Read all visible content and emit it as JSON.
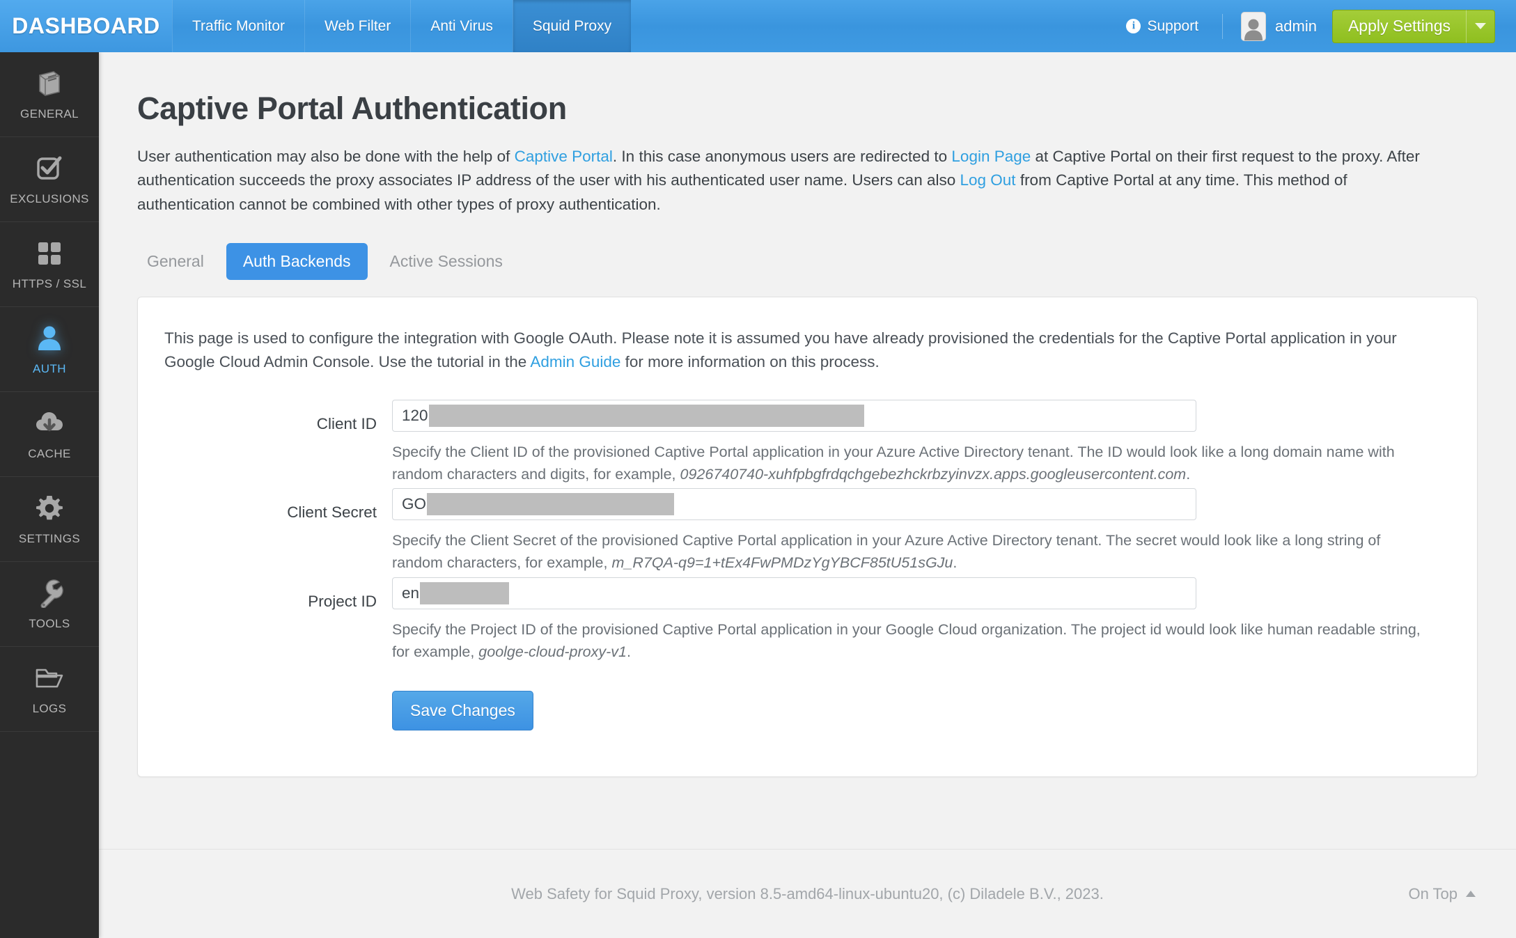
{
  "header": {
    "brand": "DASHBOARD",
    "nav": [
      {
        "label": "Traffic Monitor",
        "active": false
      },
      {
        "label": "Web Filter",
        "active": false
      },
      {
        "label": "Anti Virus",
        "active": false
      },
      {
        "label": "Squid Proxy",
        "active": true
      }
    ],
    "support_label": "Support",
    "support_icon": "info-icon",
    "user_name": "admin",
    "avatar_icon": "user-avatar-icon",
    "apply_label": "Apply Settings",
    "apply_caret_icon": "chevron-down-icon",
    "accent_blue": "#3a95de",
    "apply_green": "#8fbf1f"
  },
  "sidebar": {
    "items": [
      {
        "label": "GENERAL",
        "icon": "book-icon",
        "active": false
      },
      {
        "label": "EXCLUSIONS",
        "icon": "check-box-icon",
        "active": false
      },
      {
        "label": "HTTPS / SSL",
        "icon": "grid-icon",
        "active": false
      },
      {
        "label": "AUTH",
        "icon": "user-icon",
        "active": true
      },
      {
        "label": "CACHE",
        "icon": "cloud-download-icon",
        "active": false
      },
      {
        "label": "SETTINGS",
        "icon": "gear-icon",
        "active": false
      },
      {
        "label": "TOOLS",
        "icon": "wrench-icon",
        "active": false
      },
      {
        "label": "LOGS",
        "icon": "folder-icon",
        "active": false
      }
    ],
    "active_color": "#5bb8f5"
  },
  "page": {
    "title": "Captive Portal Authentication",
    "intro": {
      "p1": "User authentication may also be done with the help of ",
      "link1": "Captive Portal",
      "p2": ". In this case anonymous users are redirected to ",
      "link2": "Login Page",
      "p3": " at Captive Portal on their first request to the proxy. After authentication succeeds the proxy associates IP address of the user with his authenticated user name. Users can also ",
      "link3": "Log Out",
      "p4": " from Captive Portal at any time. This method of authentication cannot be combined with other types of proxy authentication."
    }
  },
  "tabs": [
    {
      "label": "General",
      "active": false
    },
    {
      "label": "Auth Backends",
      "active": true
    },
    {
      "label": "Active Sessions",
      "active": false
    }
  ],
  "panel": {
    "desc_part1": "This page is used to configure the integration with Google OAuth. Please note it is assumed you have already provisioned the credentials for the Captive Portal application in your Google Cloud Admin Console. Use the tutorial in the ",
    "desc_link": "Admin Guide",
    "desc_part2": " for more information on this process.",
    "fields": [
      {
        "label": "Client ID",
        "value": "120",
        "redacted": true,
        "redact_width": 625,
        "help_text": "Specify the Client ID of the provisioned Captive Portal application in your Azure Active Directory tenant. The ID would look like a long domain name with random characters and digits, for example, ",
        "help_example": "0926740740-xuhfpbgfrdqchgebezhckrbzyinvzx.apps.googleusercontent.com",
        "help_suffix": "."
      },
      {
        "label": "Client Secret",
        "value": "GO",
        "redacted": true,
        "redact_width": 355,
        "help_text": "Specify the Client Secret of the provisioned Captive Portal application in your Azure Active Directory tenant. The secret would look like a long string of random characters, for example, ",
        "help_example": "m_R7QA-q9=1+tEx4FwPMDzYgYBCF85tU51sGJu",
        "help_suffix": "."
      },
      {
        "label": "Project ID",
        "value": "en",
        "redacted": true,
        "redact_width": 128,
        "help_text": "Specify the Project ID of the provisioned Captive Portal application in your Google Cloud organization. The project id would look like human readable string, for example, ",
        "help_example": "goolge-cloud-proxy-v1",
        "help_suffix": "."
      }
    ],
    "save_label": "Save Changes"
  },
  "footer": {
    "text": "Web Safety for Squid Proxy, version 8.5-amd64-linux-ubuntu20, (c) Diladele B.V., 2023.",
    "ontop_label": "On Top",
    "ontop_icon": "chevron-up-icon"
  }
}
